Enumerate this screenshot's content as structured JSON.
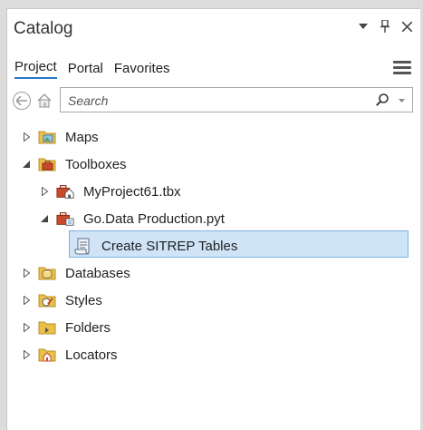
{
  "panel": {
    "title": "Catalog",
    "tabs": [
      "Project",
      "Portal",
      "Favorites"
    ]
  },
  "search": {
    "placeholder": "Search"
  },
  "tree": [
    {
      "label": "Maps",
      "icon": "maps-folder-icon"
    },
    {
      "label": "Toolboxes",
      "icon": "toolboxes-folder-icon"
    },
    {
      "label": "MyProject61.tbx",
      "icon": "toolbox-home-icon"
    },
    {
      "label": "Go.Data Production.pyt",
      "icon": "python-toolbox-icon"
    },
    {
      "label": "Create SITREP Tables",
      "icon": "script-tool-icon"
    },
    {
      "label": "Databases",
      "icon": "databases-folder-icon"
    },
    {
      "label": "Styles",
      "icon": "styles-folder-icon"
    },
    {
      "label": "Folders",
      "icon": "folders-folder-icon"
    },
    {
      "label": "Locators",
      "icon": "locators-folder-icon"
    }
  ],
  "colors": {
    "accent": "#2a78c7",
    "selection": "#cfe4f7",
    "folder": "#e8c04a"
  }
}
